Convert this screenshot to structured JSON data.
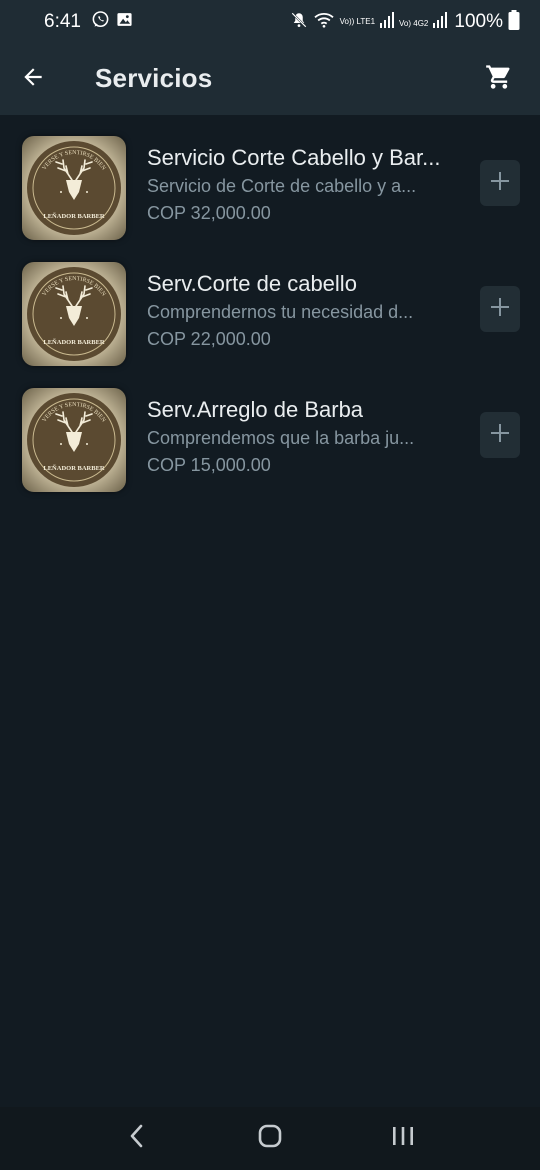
{
  "status_bar": {
    "time": "6:41",
    "battery": "100%",
    "sim1_label": "Vo)) LTE1",
    "sim2_label": "Vo) 4G2"
  },
  "app_bar": {
    "title": "Servicios"
  },
  "services": [
    {
      "logo_top": "VERSE Y SENTIRSE BIEN",
      "logo_bottom": "LEÑADOR BARBER",
      "title": "Servicio Corte Cabello y Bar...",
      "description": "Servicio de Corte de cabello y a...",
      "price": "COP 32,000.00"
    },
    {
      "logo_top": "VERSE Y SENTIRSE BIEN",
      "logo_bottom": "LEÑADOR BARBER",
      "title": "Serv.Corte de cabello",
      "description": "Comprendernos tu necesidad d...",
      "price": "COP 22,000.00"
    },
    {
      "logo_top": "VERSE Y SENTIRSE BIEN",
      "logo_bottom": "LEÑADOR BARBER",
      "title": "Serv.Arreglo de Barba",
      "description": "Comprendemos que la barba ju...",
      "price": "COP 15,000.00"
    }
  ],
  "icons": {
    "back": "arrow-left-icon",
    "cart": "shopping-cart-icon",
    "add": "plus-icon",
    "nav_back": "chevron-left-icon",
    "nav_home": "home-icon",
    "nav_recents": "recents-icon"
  },
  "colors": {
    "background": "#121b22",
    "app_bar": "#1f2c34",
    "primary_text": "#e9edef",
    "secondary_text": "#8696a0",
    "add_button": "#222e35",
    "logo_brown": "#5b4a31"
  }
}
